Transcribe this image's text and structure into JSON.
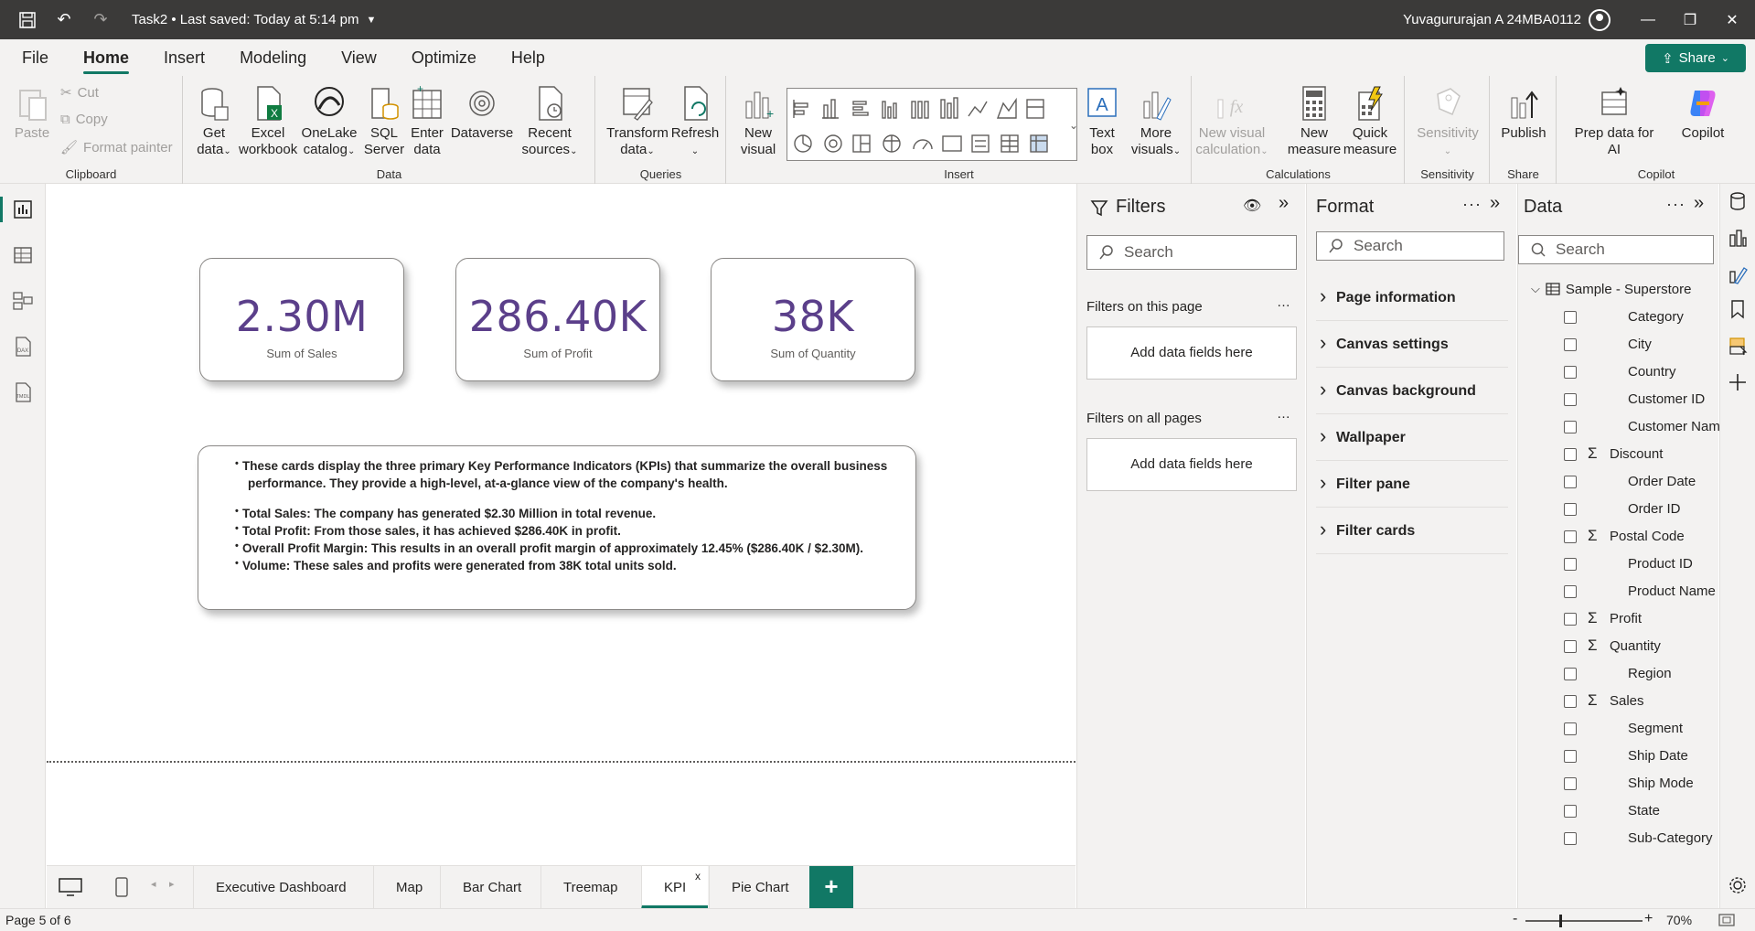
{
  "titlebar": {
    "doc_title": "Task2 • Last saved: Today at 5:14 pm",
    "user": "Yuvagururajan A 24MBA0112"
  },
  "menu": {
    "tabs": [
      "File",
      "Home",
      "Insert",
      "Modeling",
      "View",
      "Optimize",
      "Help"
    ],
    "active": "Home",
    "share": "Share"
  },
  "ribbon": {
    "clipboard": {
      "paste": "Paste",
      "cut": "Cut",
      "copy": "Copy",
      "format_painter": "Format painter",
      "label": "Clipboard"
    },
    "data": {
      "get_data": [
        "Get",
        "data"
      ],
      "excel": [
        "Excel",
        "workbook"
      ],
      "onelake": [
        "OneLake",
        "catalog"
      ],
      "sql": [
        "SQL",
        "Server"
      ],
      "enter": [
        "Enter",
        "data"
      ],
      "dataverse": "Dataverse",
      "recent": [
        "Recent",
        "sources"
      ],
      "label": "Data"
    },
    "queries": {
      "transform": [
        "Transform",
        "data"
      ],
      "refresh": "Refresh",
      "label": "Queries"
    },
    "insert": {
      "new_visual": [
        "New",
        "visual"
      ],
      "text_box": [
        "Text",
        "box"
      ],
      "more_visuals": [
        "More",
        "visuals"
      ],
      "label": "Insert"
    },
    "calculations": {
      "new_visual_calc": [
        "New visual",
        "calculation"
      ],
      "new_measure": [
        "New",
        "measure"
      ],
      "quick_measure": [
        "Quick",
        "measure"
      ],
      "label": "Calculations"
    },
    "sensitivity": {
      "btn": "Sensitivity",
      "label": "Sensitivity"
    },
    "share": {
      "publish": "Publish",
      "label": "Share"
    },
    "copilot": {
      "prep": [
        "Prep data for",
        "AI"
      ],
      "copilot": "Copilot",
      "label": "Copilot"
    }
  },
  "kpis": [
    {
      "value": "2.30M",
      "label": "Sum of Sales"
    },
    {
      "value": "286.40K",
      "label": "Sum of Profit"
    },
    {
      "value": "38K",
      "label": "Sum of Quantity"
    }
  ],
  "textbox": {
    "intro_line1": "These cards display the three primary Key Performance Indicators (KPIs) that summarize the overall business",
    "intro_line2": "performance. They provide a high-level, at-a-glance view of the company's health.",
    "b1": "Total Sales: The company has generated $2.30 Million in total revenue.",
    "b2": "Total Profit: From those sales, it has achieved $286.40K in profit.",
    "b3": "Overall Profit Margin: This results in an overall profit margin of approximately 12.45% ($286.40K / $2.30M).",
    "b4": "Volume: These sales and profits were generated from 38K total units sold."
  },
  "page_tabs": [
    "Executive Dashboard",
    "Map",
    "Bar Chart",
    "Treemap",
    "KPI",
    "Pie Chart"
  ],
  "active_tab": "KPI",
  "status": {
    "page": "Page 5 of 6",
    "zoom": "70%"
  },
  "filters": {
    "title": "Filters",
    "search_placeholder": "Search",
    "on_this_page": "Filters on this page",
    "on_all_pages": "Filters on all pages",
    "add_fields": "Add data fields here"
  },
  "format": {
    "title": "Format",
    "search_placeholder": "Search",
    "sections": [
      "Page information",
      "Canvas settings",
      "Canvas background",
      "Wallpaper",
      "Filter pane",
      "Filter cards"
    ]
  },
  "data_pane": {
    "title": "Data",
    "search_placeholder": "Search",
    "table": "Sample - Superstore",
    "fields": [
      {
        "name": "Category",
        "sigma": false
      },
      {
        "name": "City",
        "sigma": false
      },
      {
        "name": "Country",
        "sigma": false
      },
      {
        "name": "Customer ID",
        "sigma": false
      },
      {
        "name": "Customer Name",
        "sigma": false
      },
      {
        "name": "Discount",
        "sigma": true
      },
      {
        "name": "Order Date",
        "sigma": false
      },
      {
        "name": "Order ID",
        "sigma": false
      },
      {
        "name": "Postal Code",
        "sigma": true
      },
      {
        "name": "Product ID",
        "sigma": false
      },
      {
        "name": "Product Name",
        "sigma": false
      },
      {
        "name": "Profit",
        "sigma": true
      },
      {
        "name": "Quantity",
        "sigma": true
      },
      {
        "name": "Region",
        "sigma": false
      },
      {
        "name": "Sales",
        "sigma": true
      },
      {
        "name": "Segment",
        "sigma": false
      },
      {
        "name": "Ship Date",
        "sigma": false
      },
      {
        "name": "Ship Mode",
        "sigma": false
      },
      {
        "name": "State",
        "sigma": false
      },
      {
        "name": "Sub-Category",
        "sigma": false
      }
    ]
  },
  "colors": {
    "accent": "#117865",
    "kpi_value": "#5b3f8a",
    "titlebar": "#3b3a39"
  }
}
